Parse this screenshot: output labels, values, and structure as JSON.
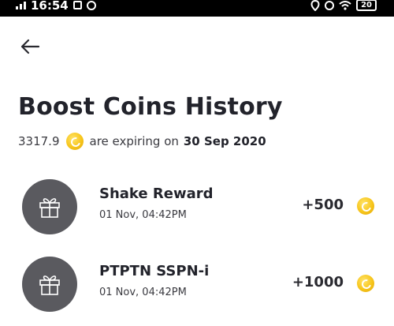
{
  "status_bar": {
    "time": "16:54",
    "battery": "20"
  },
  "header": {
    "back_icon": "arrow-left-icon",
    "title": "Boost Coins History"
  },
  "expiry": {
    "amount": "3317.9",
    "text": "are expiring on",
    "date": "30 Sep 2020",
    "coin_icon": "boost-coin-icon"
  },
  "history": [
    {
      "title": "Shake Reward",
      "time": "01 Nov, 04:42PM",
      "amount": "+500",
      "icon": "gift-icon"
    },
    {
      "title": "PTPTN SSPN-i",
      "time": "01 Nov, 04:42PM",
      "amount": "+1000",
      "icon": "gift-icon"
    }
  ],
  "colors": {
    "coin": "#f7c51a",
    "avatar_bg": "#5a5a5f",
    "text": "#22232b"
  }
}
